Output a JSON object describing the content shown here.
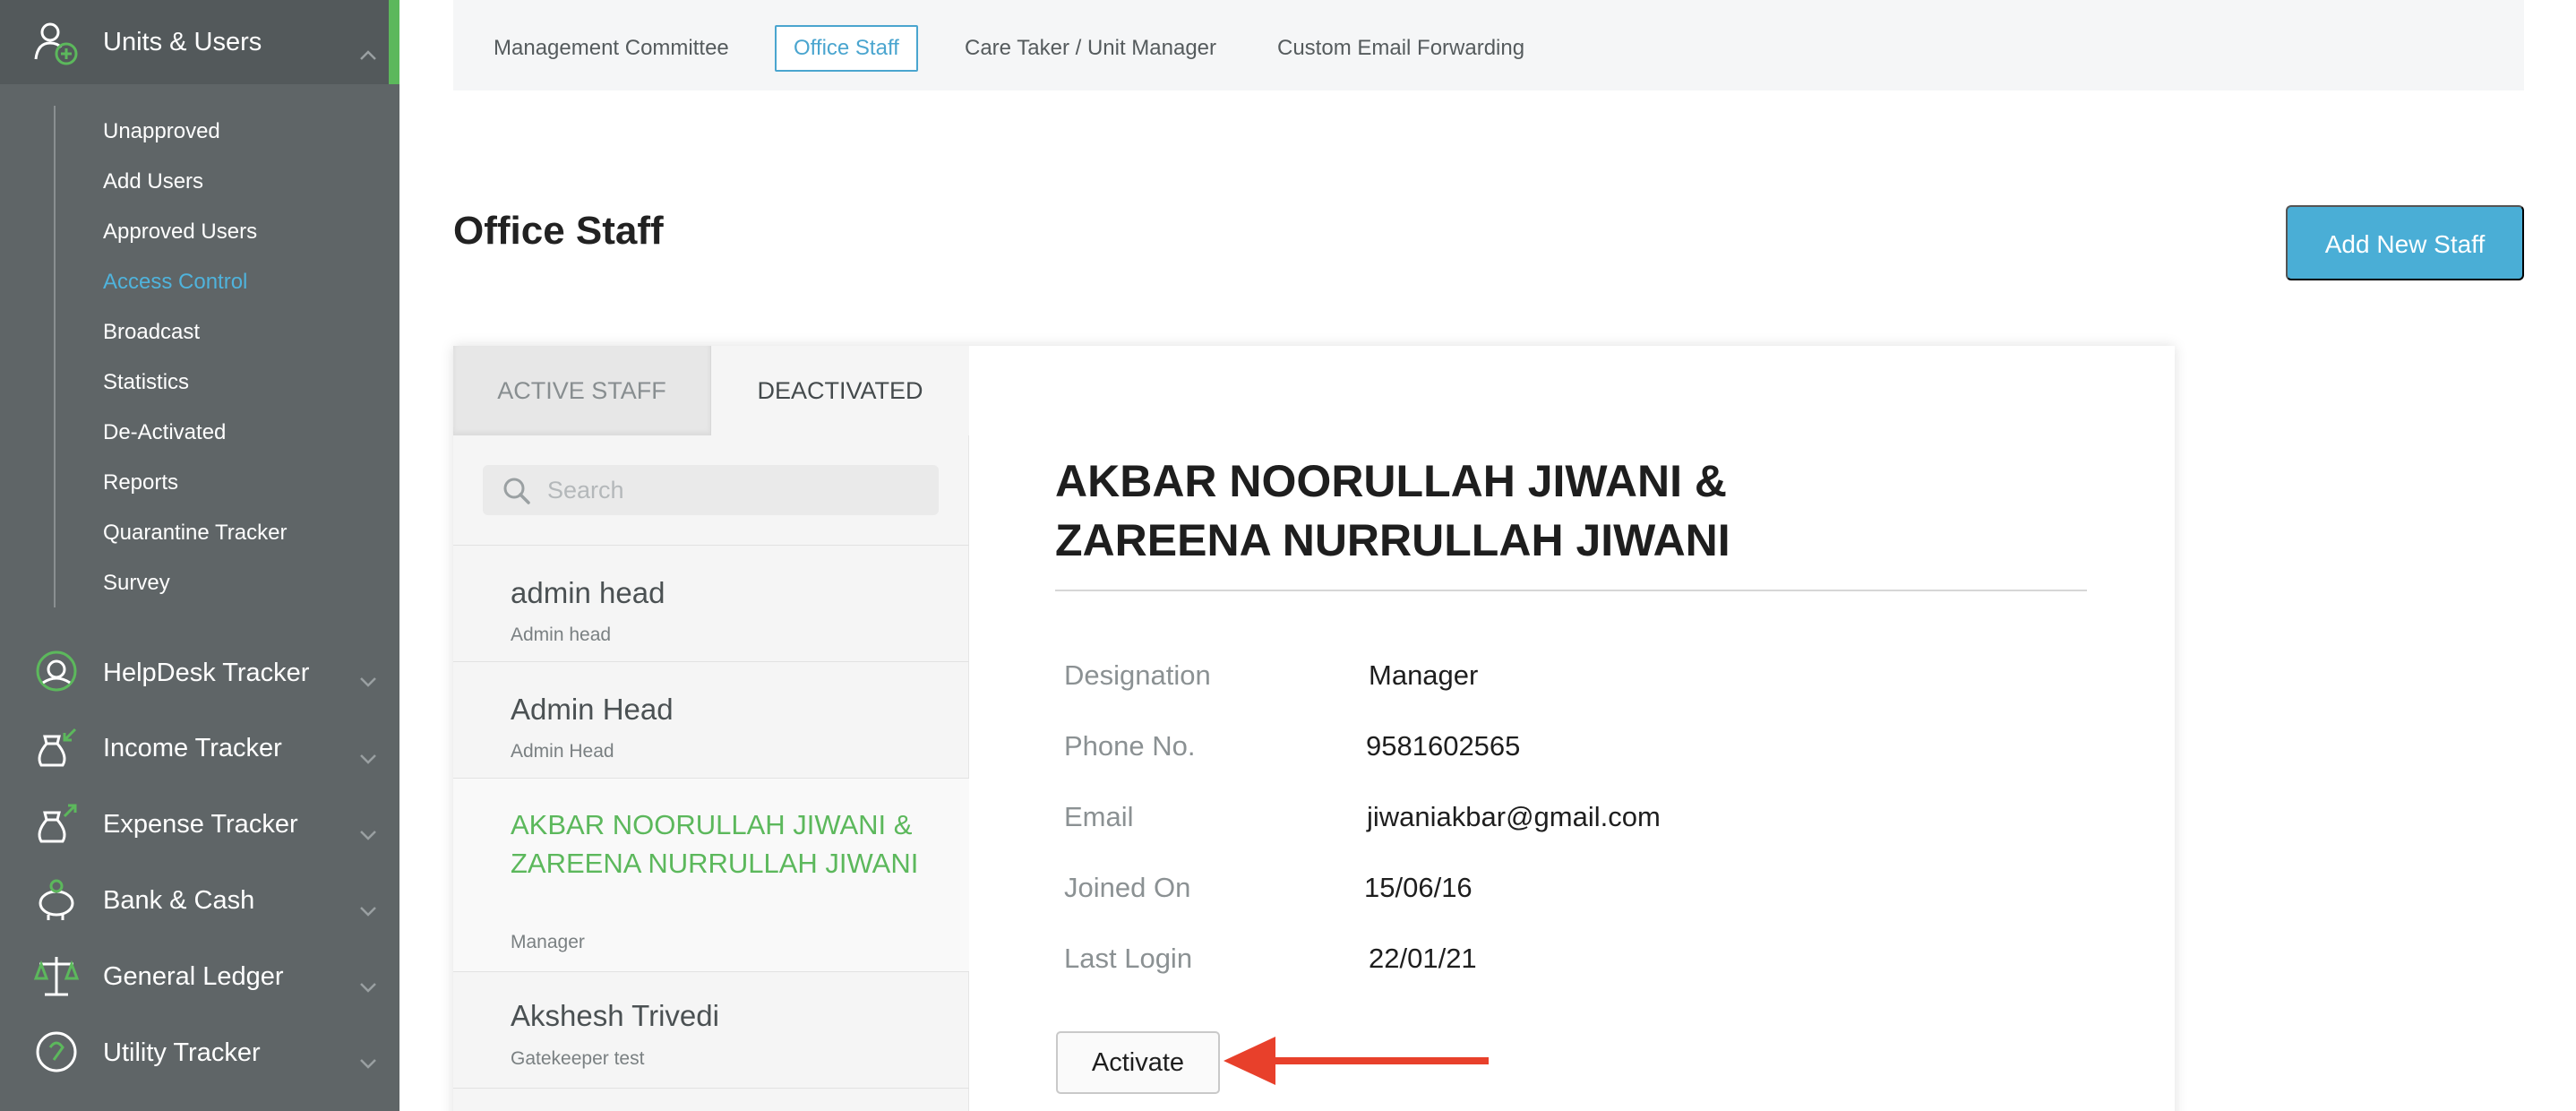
{
  "sidebar": {
    "top": {
      "label": "Units & Users",
      "icon": "add-user-icon"
    },
    "sub_items": [
      {
        "label": "Unapproved"
      },
      {
        "label": "Add Users"
      },
      {
        "label": "Approved Users"
      },
      {
        "label": "Access Control",
        "active": true
      },
      {
        "label": "Broadcast"
      },
      {
        "label": "Statistics"
      },
      {
        "label": "De-Activated"
      },
      {
        "label": "Reports"
      },
      {
        "label": "Quarantine Tracker"
      },
      {
        "label": "Survey"
      }
    ],
    "sections": [
      {
        "label": "HelpDesk Tracker",
        "icon": "headset-icon"
      },
      {
        "label": "Income Tracker",
        "icon": "money-bag-in-icon"
      },
      {
        "label": "Expense Tracker",
        "icon": "money-bag-out-icon"
      },
      {
        "label": "Bank & Cash",
        "icon": "piggy-bank-icon"
      },
      {
        "label": "General Ledger",
        "icon": "scales-icon"
      },
      {
        "label": "Utility Tracker",
        "icon": "gauge-icon"
      }
    ]
  },
  "top_tabs": [
    {
      "label": "Management Committee"
    },
    {
      "label": "Office Staff",
      "selected": true
    },
    {
      "label": "Care Taker / Unit Manager"
    },
    {
      "label": "Custom Email Forwarding"
    }
  ],
  "page": {
    "title": "Office Staff",
    "add_button": "Add New Staff"
  },
  "staff_panel": {
    "tab_active": "ACTIVE STAFF",
    "tab_deactivated": "DEACTIVATED",
    "search_placeholder": "Search",
    "items": [
      {
        "name": "admin head",
        "role": "Admin head"
      },
      {
        "name": "Admin Head",
        "role": "Admin Head"
      },
      {
        "name": "AKBAR NOORULLAH JIWANI & ZAREENA NURRULLAH JIWANI",
        "role": "Manager",
        "selected": true
      },
      {
        "name": "Akshesh Trivedi",
        "role": "Gatekeeper test"
      }
    ]
  },
  "detail": {
    "name": "AKBAR NOORULLAH JIWANI & ZAREENA NURRULLAH JIWANI",
    "fields": [
      {
        "label": "Designation",
        "value": "Manager"
      },
      {
        "label": "Phone No.",
        "value": "9581602565"
      },
      {
        "label": "Email",
        "value": "jiwaniakbar@gmail.com"
      },
      {
        "label": "Joined On",
        "value": "15/06/16"
      },
      {
        "label": "Last Login",
        "value": "22/01/21"
      }
    ],
    "activate_button": "Activate"
  },
  "colors": {
    "sidebar_bg": "#5f6567",
    "accent_green": "#5cb85c",
    "accent_blue": "#4aaed6",
    "annotation_arrow": "#e8402b"
  }
}
